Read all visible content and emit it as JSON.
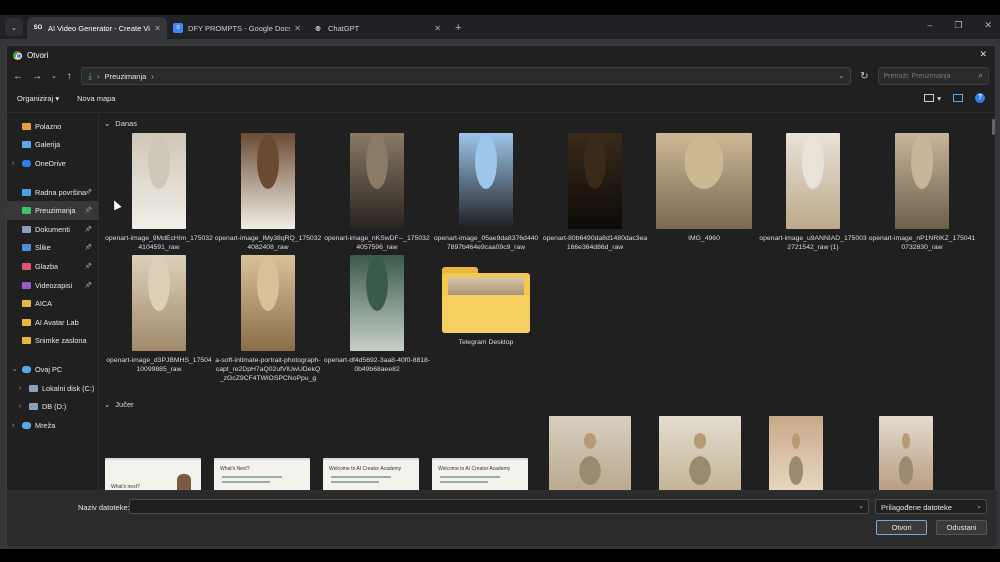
{
  "browser": {
    "tabs": [
      {
        "title": "AI Video Generator - Create Vi",
        "favicon": "heygen-icon",
        "active": true
      },
      {
        "title": "DFY PROMPTS - Google Docs",
        "favicon": "google-docs-icon",
        "active": false
      },
      {
        "title": "ChatGPT",
        "favicon": "chatgpt-icon",
        "active": false
      }
    ]
  },
  "dialog": {
    "title": "Otvori",
    "address": {
      "location": "Preuzimanja"
    },
    "search_placeholder": "Pretraži: Preuzimanja",
    "toolbar": {
      "organize": "Organiziraj",
      "new_folder": "Nova mapa"
    },
    "sidebar": [
      {
        "label": "Polazno",
        "icon": "home-icon",
        "color": "#e9a23b"
      },
      {
        "label": "Galerija",
        "icon": "gallery-icon",
        "color": "#5aa9e6"
      },
      {
        "label": "OneDrive",
        "icon": "cloud-icon",
        "color": "#2f80ed",
        "expand": true
      },
      {
        "gap": true
      },
      {
        "label": "Radna površina",
        "icon": "desktop-icon",
        "color": "#4aa3df",
        "pin": true
      },
      {
        "label": "Preuzimanja",
        "icon": "download-icon",
        "color": "#3fbf6f",
        "pin": true,
        "selected": true
      },
      {
        "label": "Dokumenti",
        "icon": "documents-icon",
        "color": "#8aa0b8",
        "pin": true
      },
      {
        "label": "Slike",
        "icon": "pictures-icon",
        "color": "#4a90d9",
        "pin": true
      },
      {
        "label": "Glazba",
        "icon": "music-icon",
        "color": "#e0556d",
        "pin": true
      },
      {
        "label": "Videozapisi",
        "icon": "videos-icon",
        "color": "#9b59d0",
        "pin": true
      },
      {
        "label": "AICA",
        "icon": "folder-icon",
        "color": "#e8b83a"
      },
      {
        "label": "AI Avatar Lab",
        "icon": "folder-icon",
        "color": "#e8b83a"
      },
      {
        "label": "Snimke zaslona",
        "icon": "folder-icon",
        "color": "#e8b83a"
      },
      {
        "gap": true
      },
      {
        "label": "Ovaj PC",
        "icon": "pc-icon",
        "color": "#5aa9e6",
        "expand": true,
        "open": true
      },
      {
        "label": "Lokalni disk (C:)",
        "icon": "drive-icon",
        "color": "#8aa0b8",
        "expand": true,
        "indent": true
      },
      {
        "label": "DB (D:)",
        "icon": "drive-icon",
        "color": "#8aa0b8",
        "expand": true,
        "indent": true
      },
      {
        "label": "Mreža",
        "icon": "network-icon",
        "color": "#5aa9e6",
        "expand": true
      }
    ],
    "groups": [
      {
        "label": "Danas"
      },
      {
        "label": "Jučer"
      }
    ],
    "files_today": [
      {
        "name": "openart-image_9MdEcHIm_1750324104591_raw",
        "colors": [
          "#cfc7b8",
          "#f2efe8"
        ]
      },
      {
        "name": "openart-image_IMy38qRQ_1750324082408_raw",
        "colors": [
          "#6b4a32",
          "#f3efe6"
        ]
      },
      {
        "name": "openart-image_nKSwDF--_1750324057596_raw",
        "colors": [
          "#8a7a66",
          "#2a2420"
        ]
      },
      {
        "name": "openart-image_05ae9da8376d4407897b464e9caa09c9_raw",
        "colors": [
          "#9ec6ea",
          "#1e1e22"
        ]
      },
      {
        "name": "openart-80b6490da8d1480dac3ea166e364d86d_raw",
        "colors": [
          "#3a2a1a",
          "#0c0a08"
        ]
      },
      {
        "name": "IMG_4960",
        "colors": [
          "#cdb894",
          "#7a6a54"
        ]
      },
      {
        "name": "openart-image_u9ANNIAD_1750032721542_raw (1)",
        "colors": [
          "#e8e2d8",
          "#bca98a"
        ]
      },
      {
        "name": "openart-image_nP1NRIKZ_1750410732830_raw",
        "colors": [
          "#c8b69a",
          "#6e5e4c"
        ]
      },
      {
        "name": "openart-image_d3PJBMHS_1750410099885_raw",
        "colors": [
          "#ddd0b8",
          "#a08a6a"
        ]
      },
      {
        "name": "a-soft-intimate-portrait-photograph-capt_re2DpH7aQ02ufVlUwUDekQ_zGcZ9CF4TWiOSPCNoPpu_g",
        "colors": [
          "#d9c19a",
          "#8a6e4a"
        ]
      },
      {
        "name": "openart-df4d5692-3aa8-40f0-8818-0b49b68aee82",
        "colors": [
          "#3a5a4a",
          "#c8d0c8"
        ]
      },
      {
        "name": "Telegram Desktop",
        "folder": true
      }
    ],
    "files_yesterday": [
      {
        "kind": "slide",
        "text": "What's next?"
      },
      {
        "kind": "slide",
        "text": "What's Next?"
      },
      {
        "kind": "slide",
        "text": "Welcome to AI Creator Academy"
      },
      {
        "kind": "slide",
        "text": "Welcome to AI Creator Academy"
      },
      {
        "kind": "photo",
        "colors": [
          "#d8cfc0",
          "#b8a88c"
        ]
      },
      {
        "kind": "photo",
        "colors": [
          "#e4ddd0",
          "#c2b294"
        ]
      },
      {
        "kind": "photo",
        "colors": [
          "#caa98a",
          "#e8d8c0"
        ]
      },
      {
        "kind": "photo",
        "colors": [
          "#e4dcd0",
          "#b89a7c"
        ]
      }
    ],
    "footer": {
      "filename_label": "Naziv datoteke:",
      "filename_value": "",
      "filetype": "Prilagođene datoteke",
      "open": "Otvori",
      "cancel": "Odustani"
    }
  }
}
